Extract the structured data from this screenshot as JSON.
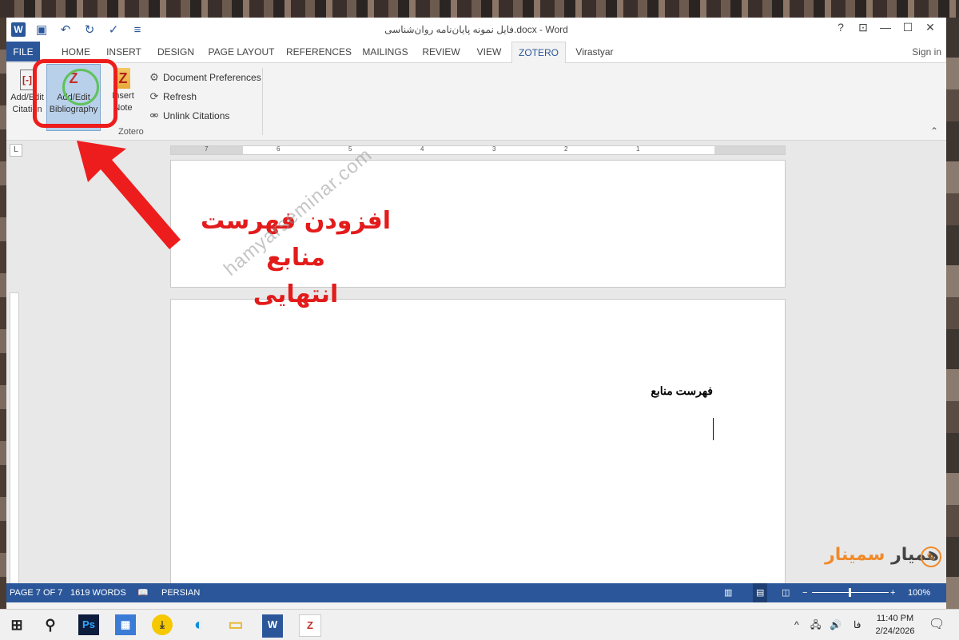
{
  "title_bar": {
    "document_title": "فایل نمونه پایان‌نامه روان‌شناسی.docx - Word",
    "help": "?",
    "controls": [
      "⊡",
      "—",
      "☐",
      "✕"
    ]
  },
  "tabs": [
    {
      "label": "FILE"
    },
    {
      "label": "HOME"
    },
    {
      "label": "INSERT"
    },
    {
      "label": "DESIGN"
    },
    {
      "label": "PAGE LAYOUT"
    },
    {
      "label": "REFERENCES"
    },
    {
      "label": "MAILINGS"
    },
    {
      "label": "REVIEW"
    },
    {
      "label": "VIEW"
    },
    {
      "label": "ZOTERO"
    },
    {
      "label": "Virastyar"
    }
  ],
  "active_tab": "ZOTERO",
  "sign_in": "Sign in",
  "ribbon": {
    "add_citation": {
      "line1": "Add/Edit",
      "line2": "Citation"
    },
    "add_bibliography": {
      "line1": "Add/Edit",
      "line2": "Bibliography"
    },
    "insert_note": {
      "line1": "Insert",
      "line2": "Note"
    },
    "document_preferences": "Document Preferences",
    "refresh": "Refresh",
    "unlink_citations": "Unlink Citations",
    "group_label": "Zotero"
  },
  "annotation": {
    "line1": "افزودن فهرست منابع",
    "line2": "انتهایی"
  },
  "document": {
    "heading": "فهرست منابع",
    "watermark": "hamyarseminar.com"
  },
  "ruler_numbers": [
    "7",
    "6",
    "5",
    "4",
    "3",
    "2",
    "1"
  ],
  "status_bar": {
    "page": "PAGE 7 OF 7",
    "words": "1619 WORDS",
    "language": "PERSIAN",
    "zoom": "100%"
  },
  "logo": {
    "part1": "همیار",
    "part2": "سمینار"
  },
  "taskbar": {
    "ps": "Ps",
    "word": "W",
    "zotero": "Z",
    "input_lang": "فا",
    "time": "11:40 PM",
    "date": "2/24/2026"
  },
  "colors": {
    "word_blue": "#2b579a",
    "annotation_red": "#e31b1b",
    "logo_orange": "#f08a2a"
  }
}
